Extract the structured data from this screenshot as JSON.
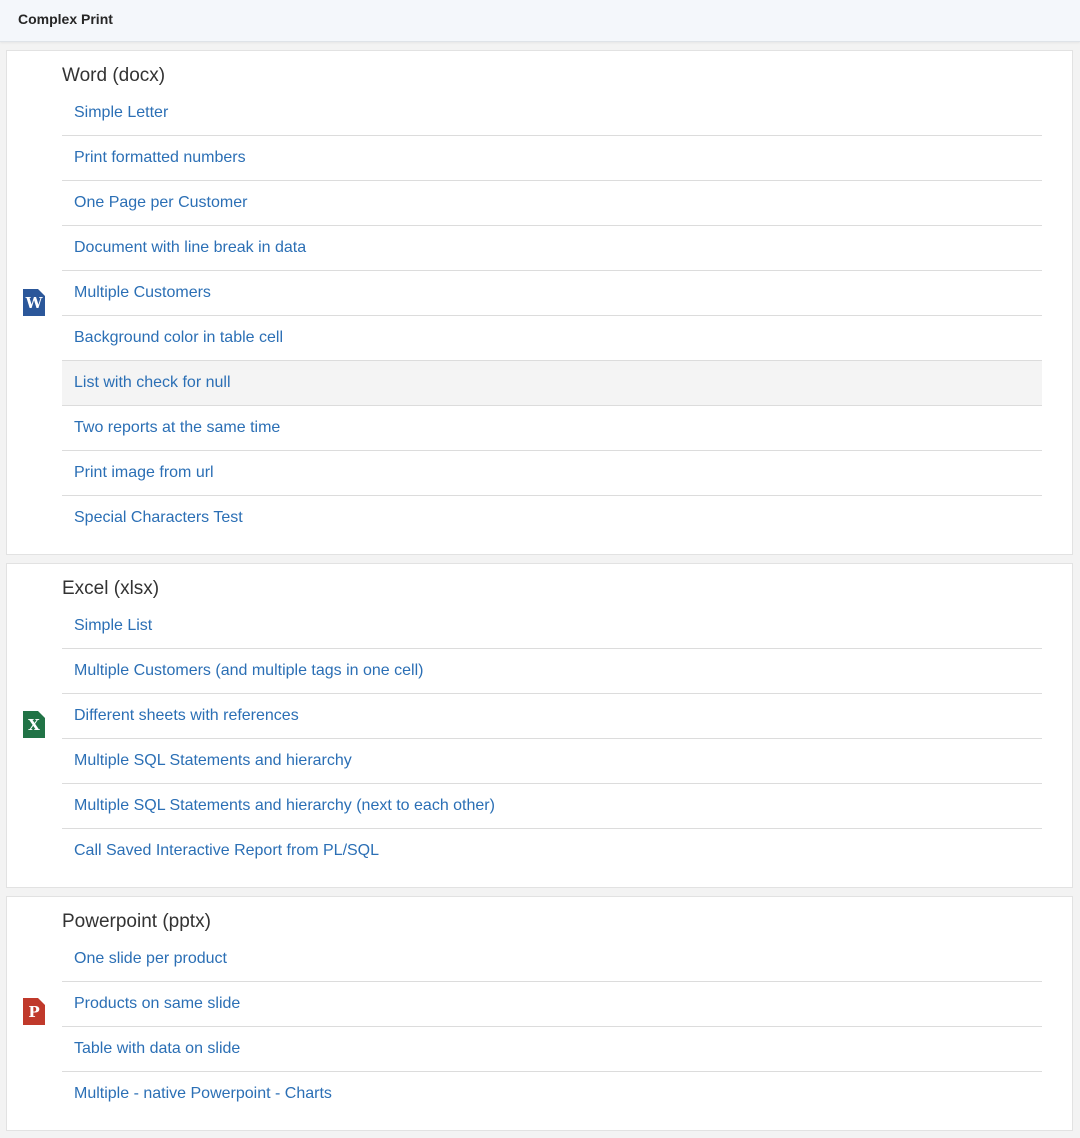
{
  "header": {
    "title": "Complex Print"
  },
  "sections": [
    {
      "title": "Word (docx)",
      "icon": {
        "name": "word-file-icon",
        "glyph": "W",
        "color": "#2b579a"
      },
      "items": [
        "Simple Letter",
        "Print formatted numbers",
        "One Page per Customer",
        "Document with line break in data",
        "Multiple Customers",
        "Background color in table cell",
        "List with check for null",
        "Two reports at the same time",
        "Print image from url",
        "Special Characters Test"
      ]
    },
    {
      "title": "Excel (xlsx)",
      "icon": {
        "name": "excel-file-icon",
        "glyph": "X",
        "color": "#217346"
      },
      "items": [
        "Simple List",
        "Multiple Customers (and multiple tags in one cell)",
        "Different sheets with references",
        "Multiple SQL Statements and hierarchy",
        "Multiple SQL Statements and hierarchy (next to each other)",
        "Call Saved Interactive Report from PL/SQL"
      ]
    },
    {
      "title": "Powerpoint (pptx)",
      "icon": {
        "name": "powerpoint-file-icon",
        "glyph": "P",
        "color": "#c0392b"
      },
      "items": [
        "One slide per product",
        "Products on same slide",
        "Table with data on slide",
        "Multiple - native Powerpoint - Charts"
      ]
    }
  ],
  "theme": {
    "link_color": "#2b6fb5",
    "highlighted_item": "List with check for null"
  }
}
